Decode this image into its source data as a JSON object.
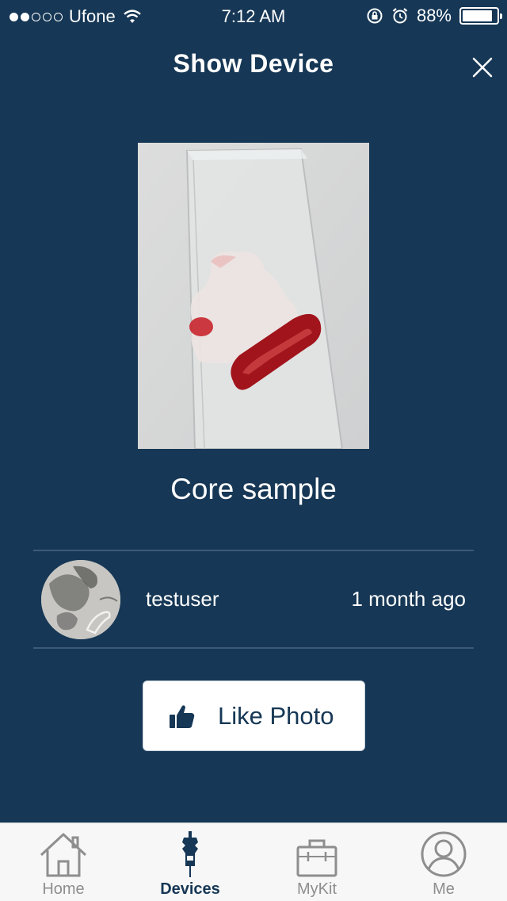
{
  "status_bar": {
    "carrier": "Ufone",
    "time": "7:12 AM",
    "battery": "88%",
    "battery_level": 0.88,
    "signal_strength": 2,
    "signal_max": 5
  },
  "header": {
    "title": "Show Device",
    "close_icon": "close-icon"
  },
  "device": {
    "name": "Core sample"
  },
  "post": {
    "username": "testuser",
    "time_ago": "1 month ago"
  },
  "like_button": {
    "label": "Like Photo",
    "icon": "thumbs-up-icon"
  },
  "tab_bar": {
    "tabs": [
      {
        "label": "Home",
        "icon": "home-icon",
        "active": false
      },
      {
        "label": "Devices",
        "icon": "device-icon",
        "active": true
      },
      {
        "label": "MyKit",
        "icon": "toolbox-icon",
        "active": false
      },
      {
        "label": "Me",
        "icon": "user-icon",
        "active": false
      }
    ]
  },
  "colors": {
    "background": "#163755",
    "accent": "#163755",
    "tab_inactive": "#8e8e8e"
  }
}
